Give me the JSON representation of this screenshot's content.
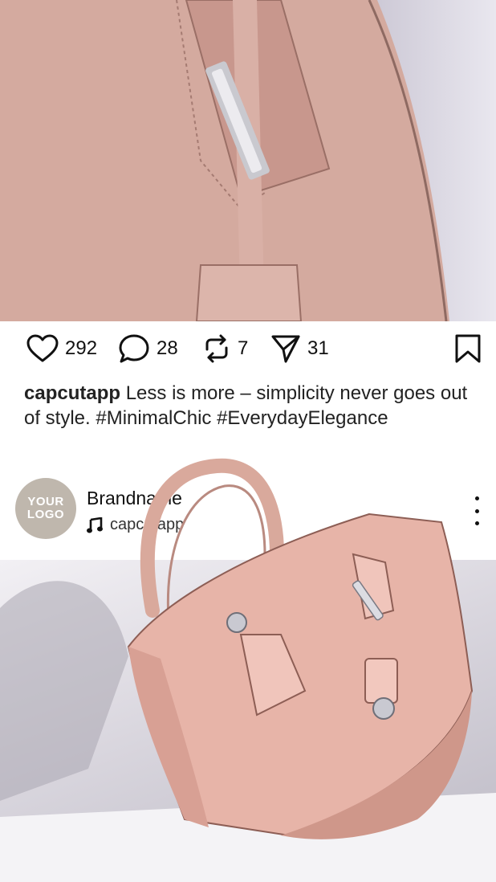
{
  "post": {
    "actions": {
      "likes": "292",
      "comments": "28",
      "reposts": "7",
      "shares": "31"
    },
    "caption": {
      "username": "capcutapp",
      "text": " Less is more – simplicity never goes out of style. #MinimalChic #EverydayElegance"
    }
  },
  "profile": {
    "logo_line1": "YOUR",
    "logo_line2": "LOGO",
    "brand_name": "Brandname",
    "audio_label": "capcutapp"
  },
  "icons": [
    "heart-icon",
    "comment-icon",
    "repost-icon",
    "send-icon",
    "bookmark-icon",
    "music-note-icon",
    "more-vertical-icon"
  ]
}
